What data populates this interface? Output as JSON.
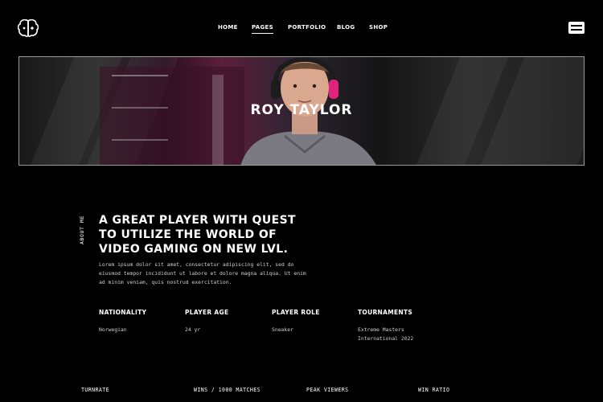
{
  "header": {
    "logo_icon": "brain-icon",
    "nav": [
      {
        "label": "HOME",
        "active": false
      },
      {
        "label": "PAGES",
        "active": true
      },
      {
        "label": "PORTFOLIO",
        "active": false
      },
      {
        "label": "BLOG",
        "active": false
      },
      {
        "label": "SHOP",
        "active": false
      }
    ],
    "menu_icon": "menu-icon"
  },
  "hero": {
    "title": "ROY TAYLOR",
    "image": "gamer-portrait"
  },
  "about": {
    "side_label": "ABOUT ME",
    "headline": [
      "A GREAT PLAYER WITH QUEST",
      "TO UTILIZE THE WORLD OF",
      "VIDEO GAMING ON NEW LVL."
    ],
    "body": [
      "Lorem ipsum dolor sit amet, consectetur adipiscing elit, sed do",
      "eiusmod tempor incididunt ut labore et dolore magna aliqua. Ut enim",
      "ad minim veniam, quis nostrud exercitation."
    ]
  },
  "facts": [
    {
      "label": "NATIONALITY",
      "value": [
        "Norwegian"
      ]
    },
    {
      "label": "PLAYER AGE",
      "value": [
        "24 yr"
      ]
    },
    {
      "label": "PLAYER ROLE",
      "value": [
        "Sneaker"
      ]
    },
    {
      "label": "TOURNAMENTS",
      "value": [
        "Extreme Masters",
        "International 2022"
      ]
    }
  ],
  "stats": [
    "TURNRATE",
    "WINS / 1000 MATCHES",
    "PEAK VIEWERS",
    "WIN RATIO"
  ],
  "colors": {
    "background": "#000000",
    "text": "#ffffff",
    "accent": "#e0247c"
  }
}
